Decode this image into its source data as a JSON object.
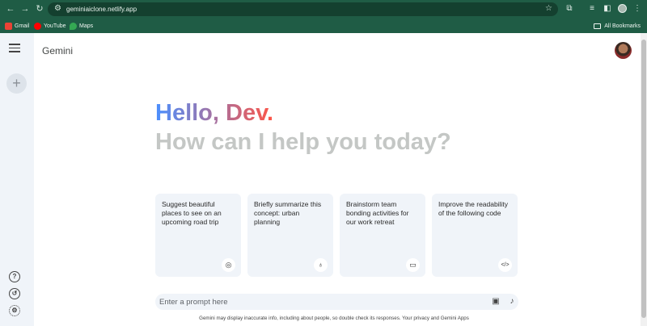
{
  "browser": {
    "url": "geminiaiclone.netlify.app",
    "bookmarks": [
      {
        "label": "Gmail",
        "color": "#ea4335"
      },
      {
        "label": "YouTube",
        "color": "#ff0000"
      },
      {
        "label": "Maps",
        "color": "#34a853"
      }
    ],
    "all_bookmarks_label": "All Bookmarks"
  },
  "app": {
    "brand": "Gemini",
    "greeting": "Hello, Dev.",
    "subtitle": "How can I help you today?",
    "cards": [
      {
        "text": "Suggest beautiful places to see on an upcoming road trip",
        "icon": "compass-icon"
      },
      {
        "text": "Briefly summarize this concept: urban planning",
        "icon": "bulb-icon"
      },
      {
        "text": "Brainstorm team bonding activities for our work retreat",
        "icon": "message-icon"
      },
      {
        "text": "Improve the readability of the following code",
        "icon": "code-icon"
      }
    ],
    "prompt_placeholder": "Enter a prompt here",
    "disclaimer": "Gemini may display inaccurate info, including about people, so double check its responses. Your privacy and Gemini Apps"
  },
  "colors": {
    "chrome": "#1f5c45",
    "sidebar": "#f0f4f9",
    "greeting_start": "#4b90ff",
    "greeting_end": "#ff5546",
    "subtitle": "#c4c7c5"
  }
}
